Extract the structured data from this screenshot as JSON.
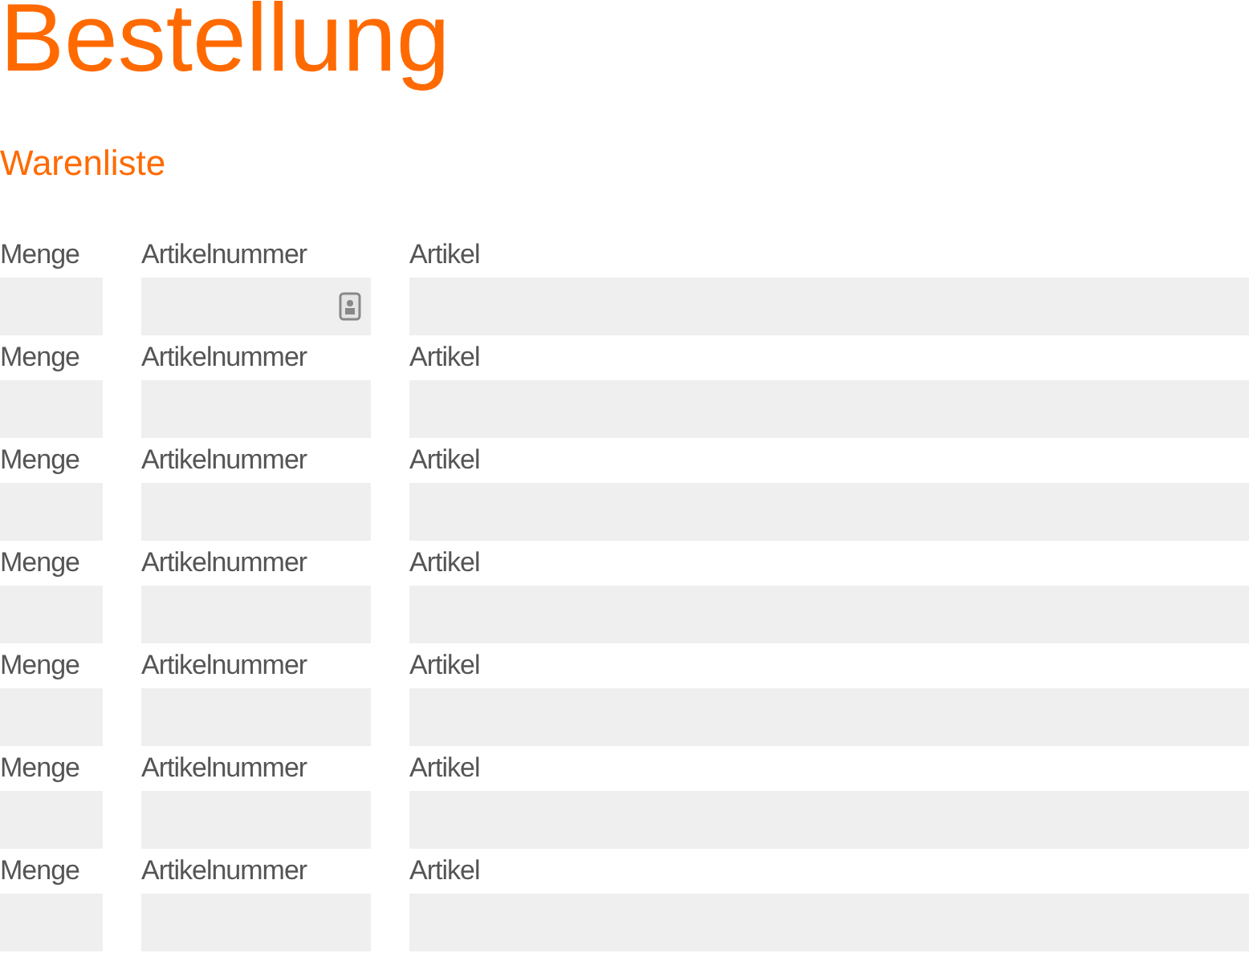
{
  "title": "Bestellung",
  "section": "Warenliste",
  "rows": [
    {
      "fields": [
        {
          "label": "Menge",
          "autofill_icon": false
        },
        {
          "label": "Artikelnummer",
          "autofill_icon": true
        },
        {
          "label": "Artikel",
          "autofill_icon": false
        }
      ]
    },
    {
      "fields": [
        {
          "label": "Menge",
          "autofill_icon": false
        },
        {
          "label": "Artikelnummer",
          "autofill_icon": false
        },
        {
          "label": "Artikel",
          "autofill_icon": false
        }
      ]
    },
    {
      "fields": [
        {
          "label": "Menge",
          "autofill_icon": false
        },
        {
          "label": "Artikelnummer",
          "autofill_icon": false
        },
        {
          "label": "Artikel",
          "autofill_icon": false
        }
      ]
    },
    {
      "fields": [
        {
          "label": "Menge",
          "autofill_icon": false
        },
        {
          "label": "Artikelnummer",
          "autofill_icon": false
        },
        {
          "label": "Artikel",
          "autofill_icon": false
        }
      ]
    },
    {
      "fields": [
        {
          "label": "Menge",
          "autofill_icon": false
        },
        {
          "label": "Artikelnummer",
          "autofill_icon": false
        },
        {
          "label": "Artikel",
          "autofill_icon": false
        }
      ]
    },
    {
      "fields": [
        {
          "label": "Menge",
          "autofill_icon": false
        },
        {
          "label": "Artikelnummer",
          "autofill_icon": false
        },
        {
          "label": "Artikel",
          "autofill_icon": false
        }
      ]
    },
    {
      "fields": [
        {
          "label": "Menge",
          "autofill_icon": false
        },
        {
          "label": "Artikelnummer",
          "autofill_icon": false
        },
        {
          "label": "Artikel",
          "autofill_icon": false
        }
      ]
    }
  ]
}
